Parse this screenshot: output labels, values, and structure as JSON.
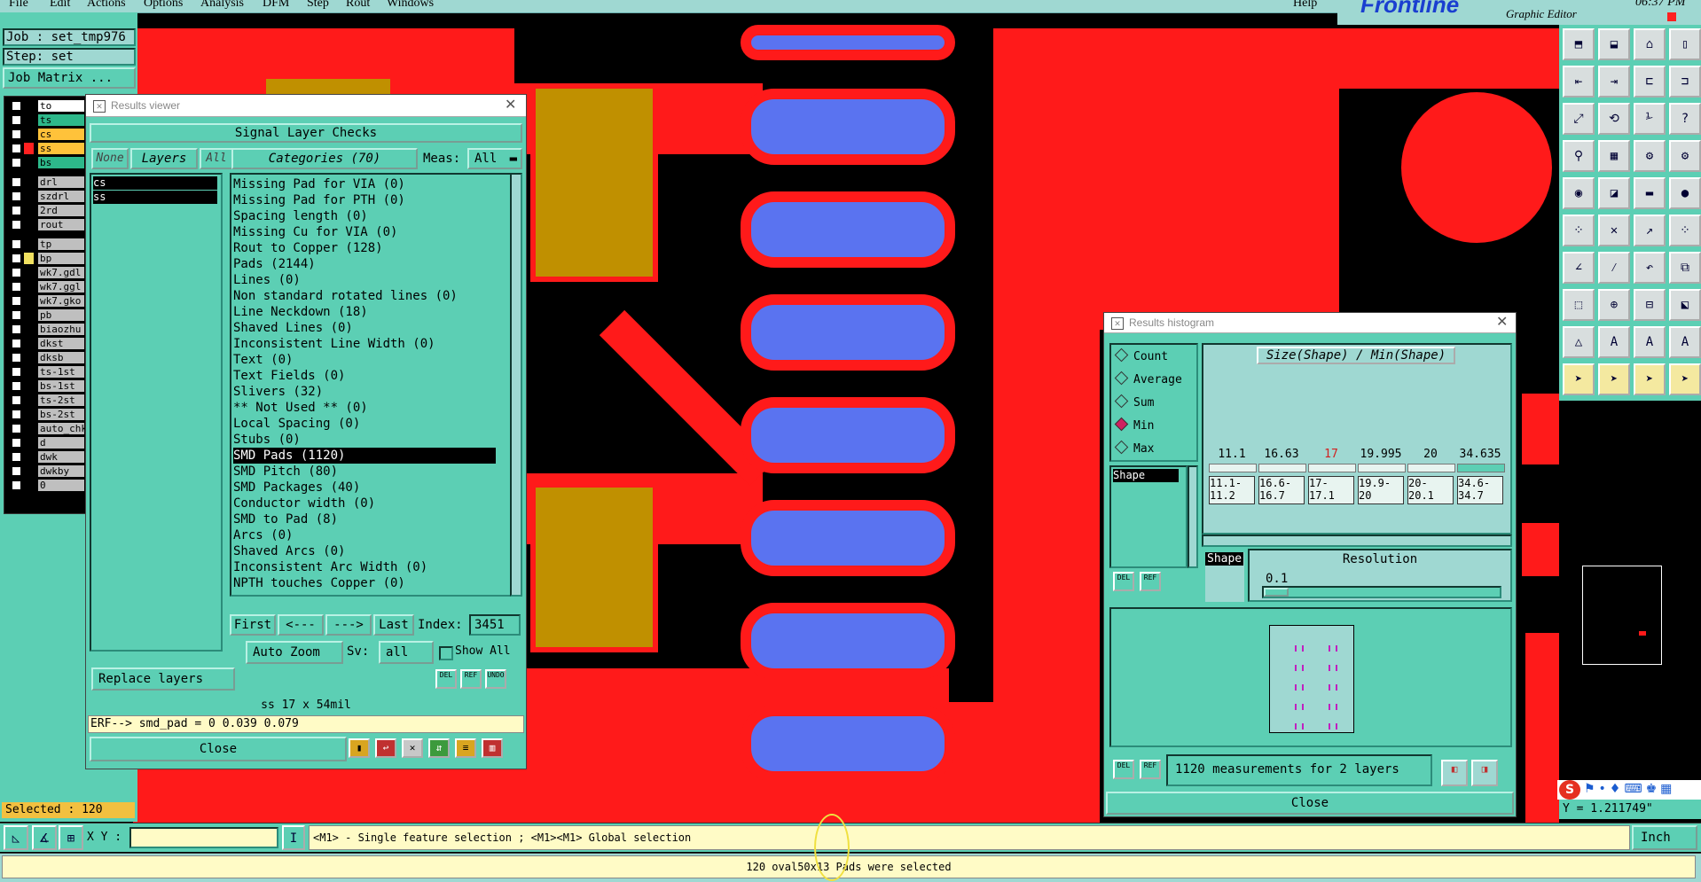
{
  "menu": [
    "File",
    "Edit",
    "Actions",
    "Options",
    "Analysis",
    "DFM",
    "Step",
    "Rout",
    "Windows"
  ],
  "help_label": "Help",
  "brand": {
    "name": "Frontline",
    "subtitle": "Graphic Editor",
    "clock": "06:37 PM"
  },
  "job": {
    "job_label": "Job : set_tmp976",
    "step_label": "Step: set",
    "matrix_btn": "Job Matrix ..."
  },
  "layers": [
    {
      "name": "to",
      "color": "#ffffff",
      "swatch": "#000000"
    },
    {
      "name": "ts",
      "color": "#2db88a",
      "swatch": "#000000"
    },
    {
      "name": "cs",
      "color": "#ffc23a",
      "swatch": "#000000"
    },
    {
      "name": "ss",
      "color": "#ffc23a",
      "swatch": "#ff2020"
    },
    {
      "name": "bs",
      "color": "#2db88a",
      "swatch": "#000000"
    },
    {
      "name": "drl",
      "color": "#bfbfbf",
      "swatch": "#000000"
    },
    {
      "name": "szdrl",
      "color": "#bfbfbf",
      "swatch": "#000000"
    },
    {
      "name": "2rd",
      "color": "#bfbfbf",
      "swatch": "#000000"
    },
    {
      "name": "rout",
      "color": "#bfbfbf",
      "swatch": "#000000"
    },
    {
      "name": "tp",
      "color": "#bfbfbf",
      "swatch": "#000000"
    },
    {
      "name": "bp",
      "color": "#bfbfbf",
      "swatch": "#f0e060"
    },
    {
      "name": "wk7.gdl",
      "color": "#bfbfbf",
      "swatch": "#000000"
    },
    {
      "name": "wk7.ggl",
      "color": "#bfbfbf",
      "swatch": "#000000"
    },
    {
      "name": "wk7.gko",
      "color": "#bfbfbf",
      "swatch": "#000000"
    },
    {
      "name": "pb",
      "color": "#bfbfbf",
      "swatch": "#000000"
    },
    {
      "name": "biaozhu",
      "color": "#bfbfbf",
      "swatch": "#000000"
    },
    {
      "name": "dkst",
      "color": "#bfbfbf",
      "swatch": "#000000"
    },
    {
      "name": "dksb",
      "color": "#bfbfbf",
      "swatch": "#000000"
    },
    {
      "name": "ts-1st",
      "color": "#bfbfbf",
      "swatch": "#000000"
    },
    {
      "name": "bs-1st",
      "color": "#bfbfbf",
      "swatch": "#000000"
    },
    {
      "name": "ts-2st",
      "color": "#bfbfbf",
      "swatch": "#000000"
    },
    {
      "name": "bs-2st",
      "color": "#bfbfbf",
      "swatch": "#000000"
    },
    {
      "name": "auto_chk",
      "color": "#bfbfbf",
      "swatch": "#000000"
    },
    {
      "name": "d",
      "color": "#bfbfbf",
      "swatch": "#000000"
    },
    {
      "name": "dwk",
      "color": "#bfbfbf",
      "swatch": "#000000"
    },
    {
      "name": "dwkby",
      "color": "#bfbfbf",
      "swatch": "#000000"
    },
    {
      "name": "0",
      "color": "#bfbfbf",
      "swatch": "#000000"
    }
  ],
  "selected_label": "Selected : 120",
  "results_viewer": {
    "title": "Results viewer",
    "header": "Signal Layer Checks",
    "none_btn": "None",
    "layers_btn": "Layers",
    "all_btn": "All",
    "categories_btn": "Categories (70)",
    "meas_label": "Meas:",
    "meas_value": "All",
    "layer_list": [
      "cs",
      "ss"
    ],
    "categories": [
      "Missing Pad for VIA (0)",
      "Missing Pad for PTH (0)",
      "Spacing length (0)",
      "Missing Cu for VIA (0)",
      "Rout to Copper (128)",
      "Pads (2144)",
      "Lines (0)",
      "Non standard rotated lines (0)",
      "Line Neckdown (18)",
      "Shaved Lines (0)",
      "Inconsistent Line Width (0)",
      "Text (0)",
      "Text Fields (0)",
      "Slivers (32)",
      "** Not Used ** (0)",
      "Local Spacing (0)",
      "Stubs (0)",
      "SMD Pads (1120)",
      "SMD Pitch (80)",
      "SMD Packages (40)",
      "Conductor width (0)",
      "SMD to Pad (8)",
      "Arcs (0)",
      "Shaved Arcs (0)",
      "Inconsistent Arc Width (0)",
      "NPTH touches Copper (0)"
    ],
    "selected_category": "SMD Pads (1120)",
    "first_btn": "First",
    "prev_btn": "<---",
    "next_btn": "--->",
    "last_btn": "Last",
    "index_label": "Index:",
    "index_value": "3451",
    "autozoom_btn": "Auto Zoom",
    "sv_label": "Sv:",
    "sv_value": "all",
    "show_all_label": "Show All",
    "replace_layers_btn": "Replace layers",
    "measure_line": "ss 17 x 54mil",
    "erf_line": "ERF--> smd_pad = 0 0.039 0.079",
    "close_btn": "Close",
    "del_label": "DEL",
    "ref_label": "REF",
    "undo_label": "UNDO"
  },
  "histogram": {
    "title": "Results histogram",
    "modes": [
      "Count",
      "Average",
      "Sum",
      "Min",
      "Max"
    ],
    "selected_mode": "Min",
    "shape_label": "Shape",
    "chart_title": "Size(Shape) / Min(Shape)",
    "bar_values": [
      "11.1",
      "16.63",
      "17",
      "19.995",
      "20",
      "34.635"
    ],
    "bar_ranges": [
      "11.1-\n11.2",
      "16.6-\n16.7",
      "17-\n17.1",
      "19.9-\n20",
      "20-\n20.1",
      "34.6-\n34.7"
    ],
    "resolution_label": "Resolution",
    "resolution_value": "0.1",
    "measurements": "1120 measurements for 2 layers",
    "close_btn": "Close",
    "del_label": "DEL",
    "ref_label": "REF"
  },
  "bottom": {
    "xy_label": "X Y :",
    "hint": "<M1> - Single feature selection ; <M1><M1> Global selection",
    "units": "Inch",
    "status": "120 oval50x13 Pads were selected",
    "y_readout": "Y = 1.211749\""
  },
  "colors": {
    "copper": "#ff1a1a",
    "pad": "#5a73f0",
    "gold": "#c09000",
    "panel": "#5ccfb4",
    "menubar": "#9fd8d2"
  }
}
